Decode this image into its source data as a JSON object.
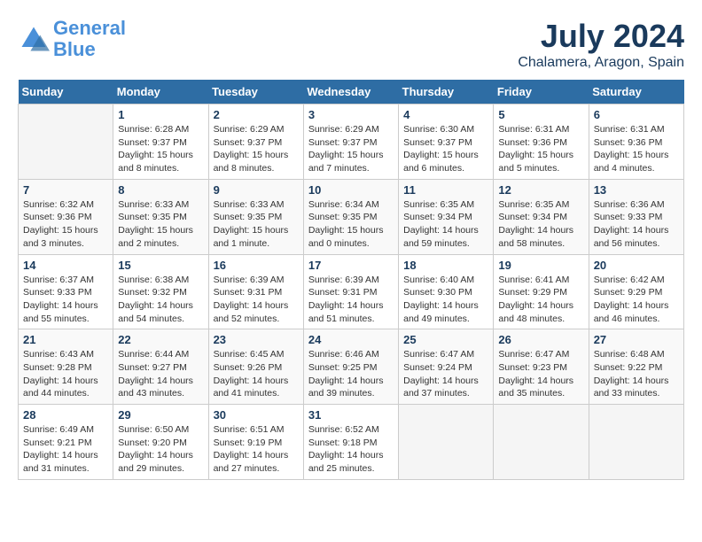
{
  "header": {
    "logo_line1": "General",
    "logo_line2": "Blue",
    "month": "July 2024",
    "location": "Chalamera, Aragon, Spain"
  },
  "columns": [
    "Sunday",
    "Monday",
    "Tuesday",
    "Wednesday",
    "Thursday",
    "Friday",
    "Saturday"
  ],
  "weeks": [
    [
      {
        "day": "",
        "sunrise": "",
        "sunset": "",
        "daylight": ""
      },
      {
        "day": "1",
        "sunrise": "Sunrise: 6:28 AM",
        "sunset": "Sunset: 9:37 PM",
        "daylight": "Daylight: 15 hours and 8 minutes."
      },
      {
        "day": "2",
        "sunrise": "Sunrise: 6:29 AM",
        "sunset": "Sunset: 9:37 PM",
        "daylight": "Daylight: 15 hours and 8 minutes."
      },
      {
        "day": "3",
        "sunrise": "Sunrise: 6:29 AM",
        "sunset": "Sunset: 9:37 PM",
        "daylight": "Daylight: 15 hours and 7 minutes."
      },
      {
        "day": "4",
        "sunrise": "Sunrise: 6:30 AM",
        "sunset": "Sunset: 9:37 PM",
        "daylight": "Daylight: 15 hours and 6 minutes."
      },
      {
        "day": "5",
        "sunrise": "Sunrise: 6:31 AM",
        "sunset": "Sunset: 9:36 PM",
        "daylight": "Daylight: 15 hours and 5 minutes."
      },
      {
        "day": "6",
        "sunrise": "Sunrise: 6:31 AM",
        "sunset": "Sunset: 9:36 PM",
        "daylight": "Daylight: 15 hours and 4 minutes."
      }
    ],
    [
      {
        "day": "7",
        "sunrise": "Sunrise: 6:32 AM",
        "sunset": "Sunset: 9:36 PM",
        "daylight": "Daylight: 15 hours and 3 minutes."
      },
      {
        "day": "8",
        "sunrise": "Sunrise: 6:33 AM",
        "sunset": "Sunset: 9:35 PM",
        "daylight": "Daylight: 15 hours and 2 minutes."
      },
      {
        "day": "9",
        "sunrise": "Sunrise: 6:33 AM",
        "sunset": "Sunset: 9:35 PM",
        "daylight": "Daylight: 15 hours and 1 minute."
      },
      {
        "day": "10",
        "sunrise": "Sunrise: 6:34 AM",
        "sunset": "Sunset: 9:35 PM",
        "daylight": "Daylight: 15 hours and 0 minutes."
      },
      {
        "day": "11",
        "sunrise": "Sunrise: 6:35 AM",
        "sunset": "Sunset: 9:34 PM",
        "daylight": "Daylight: 14 hours and 59 minutes."
      },
      {
        "day": "12",
        "sunrise": "Sunrise: 6:35 AM",
        "sunset": "Sunset: 9:34 PM",
        "daylight": "Daylight: 14 hours and 58 minutes."
      },
      {
        "day": "13",
        "sunrise": "Sunrise: 6:36 AM",
        "sunset": "Sunset: 9:33 PM",
        "daylight": "Daylight: 14 hours and 56 minutes."
      }
    ],
    [
      {
        "day": "14",
        "sunrise": "Sunrise: 6:37 AM",
        "sunset": "Sunset: 9:33 PM",
        "daylight": "Daylight: 14 hours and 55 minutes."
      },
      {
        "day": "15",
        "sunrise": "Sunrise: 6:38 AM",
        "sunset": "Sunset: 9:32 PM",
        "daylight": "Daylight: 14 hours and 54 minutes."
      },
      {
        "day": "16",
        "sunrise": "Sunrise: 6:39 AM",
        "sunset": "Sunset: 9:31 PM",
        "daylight": "Daylight: 14 hours and 52 minutes."
      },
      {
        "day": "17",
        "sunrise": "Sunrise: 6:39 AM",
        "sunset": "Sunset: 9:31 PM",
        "daylight": "Daylight: 14 hours and 51 minutes."
      },
      {
        "day": "18",
        "sunrise": "Sunrise: 6:40 AM",
        "sunset": "Sunset: 9:30 PM",
        "daylight": "Daylight: 14 hours and 49 minutes."
      },
      {
        "day": "19",
        "sunrise": "Sunrise: 6:41 AM",
        "sunset": "Sunset: 9:29 PM",
        "daylight": "Daylight: 14 hours and 48 minutes."
      },
      {
        "day": "20",
        "sunrise": "Sunrise: 6:42 AM",
        "sunset": "Sunset: 9:29 PM",
        "daylight": "Daylight: 14 hours and 46 minutes."
      }
    ],
    [
      {
        "day": "21",
        "sunrise": "Sunrise: 6:43 AM",
        "sunset": "Sunset: 9:28 PM",
        "daylight": "Daylight: 14 hours and 44 minutes."
      },
      {
        "day": "22",
        "sunrise": "Sunrise: 6:44 AM",
        "sunset": "Sunset: 9:27 PM",
        "daylight": "Daylight: 14 hours and 43 minutes."
      },
      {
        "day": "23",
        "sunrise": "Sunrise: 6:45 AM",
        "sunset": "Sunset: 9:26 PM",
        "daylight": "Daylight: 14 hours and 41 minutes."
      },
      {
        "day": "24",
        "sunrise": "Sunrise: 6:46 AM",
        "sunset": "Sunset: 9:25 PM",
        "daylight": "Daylight: 14 hours and 39 minutes."
      },
      {
        "day": "25",
        "sunrise": "Sunrise: 6:47 AM",
        "sunset": "Sunset: 9:24 PM",
        "daylight": "Daylight: 14 hours and 37 minutes."
      },
      {
        "day": "26",
        "sunrise": "Sunrise: 6:47 AM",
        "sunset": "Sunset: 9:23 PM",
        "daylight": "Daylight: 14 hours and 35 minutes."
      },
      {
        "day": "27",
        "sunrise": "Sunrise: 6:48 AM",
        "sunset": "Sunset: 9:22 PM",
        "daylight": "Daylight: 14 hours and 33 minutes."
      }
    ],
    [
      {
        "day": "28",
        "sunrise": "Sunrise: 6:49 AM",
        "sunset": "Sunset: 9:21 PM",
        "daylight": "Daylight: 14 hours and 31 minutes."
      },
      {
        "day": "29",
        "sunrise": "Sunrise: 6:50 AM",
        "sunset": "Sunset: 9:20 PM",
        "daylight": "Daylight: 14 hours and 29 minutes."
      },
      {
        "day": "30",
        "sunrise": "Sunrise: 6:51 AM",
        "sunset": "Sunset: 9:19 PM",
        "daylight": "Daylight: 14 hours and 27 minutes."
      },
      {
        "day": "31",
        "sunrise": "Sunrise: 6:52 AM",
        "sunset": "Sunset: 9:18 PM",
        "daylight": "Daylight: 14 hours and 25 minutes."
      },
      {
        "day": "",
        "sunrise": "",
        "sunset": "",
        "daylight": ""
      },
      {
        "day": "",
        "sunrise": "",
        "sunset": "",
        "daylight": ""
      },
      {
        "day": "",
        "sunrise": "",
        "sunset": "",
        "daylight": ""
      }
    ]
  ]
}
